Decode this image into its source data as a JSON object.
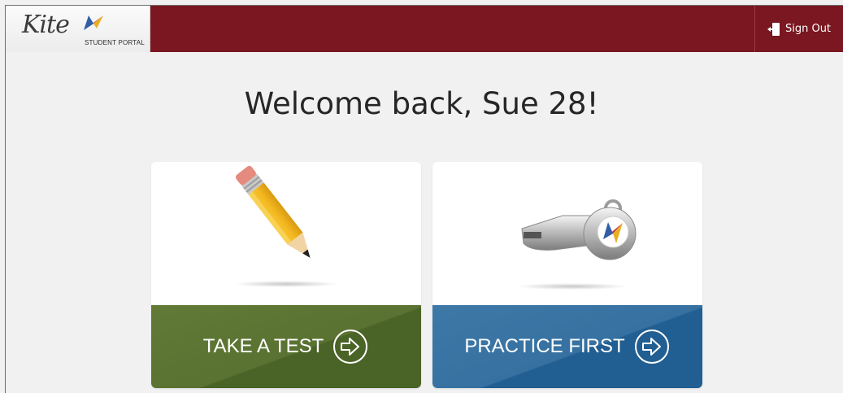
{
  "header": {
    "logo_name": "Kite",
    "logo_subtitle": "STUDENT PORTAL",
    "sign_out_label": "Sign Out",
    "color": "#7a1720"
  },
  "welcome": "Welcome back, Sue 28!",
  "cards": [
    {
      "label": "TAKE A TEST",
      "icon": "pencil-icon",
      "color": "#5a7232"
    },
    {
      "label": "PRACTICE FIRST",
      "icon": "whistle-icon",
      "color": "#3671a1"
    }
  ]
}
